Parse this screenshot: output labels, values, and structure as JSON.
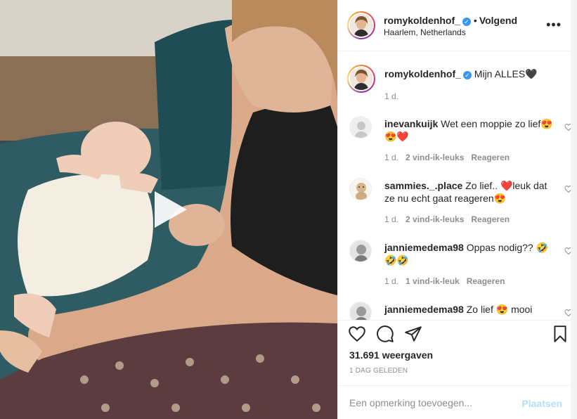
{
  "post": {
    "username": "romykoldenhof_",
    "follow_status": "Volgend",
    "location": "Haarlem, Netherlands",
    "more_label": "•••"
  },
  "caption": {
    "username": "romykoldenhof_",
    "text": "Mijn ALLES🖤",
    "time": "1 d."
  },
  "comments": [
    {
      "username": "inevankuijk",
      "text": "Wet een moppie zo lief😍😍❤️",
      "time": "1 d.",
      "likes": "2 vind-ik-leuks",
      "reply": "Reageren"
    },
    {
      "username": "sammies._.place",
      "text": "Zo lief.. ❤️leuk dat ze nu echt gaat reageren😍",
      "time": "1 d.",
      "likes": "2 vind-ik-leuks",
      "reply": "Reageren"
    },
    {
      "username": "janniemedema98",
      "text": "Oppas nodig?? 🤣🤣🤣",
      "time": "1 d.",
      "likes": "1 vind-ik-leuk",
      "reply": "Reageren"
    },
    {
      "username": "janniemedema98",
      "text": "Zo lief 😍 mooi",
      "time": "",
      "likes": "",
      "reply": ""
    }
  ],
  "stats": {
    "views": "31.691 weergaven",
    "date": "1 DAG GELEDEN"
  },
  "add_comment": {
    "placeholder": "Een opmerking toevoegen...",
    "post_label": "Plaatsen"
  },
  "colors": {
    "link_blue": "#3897f0",
    "post_disabled": "#b2dffc",
    "secondary_text": "#8e8e8e"
  },
  "icons": [
    "play-icon",
    "verified-icon",
    "heart-icon",
    "comment-icon",
    "share-icon",
    "bookmark-icon",
    "more-icon"
  ]
}
